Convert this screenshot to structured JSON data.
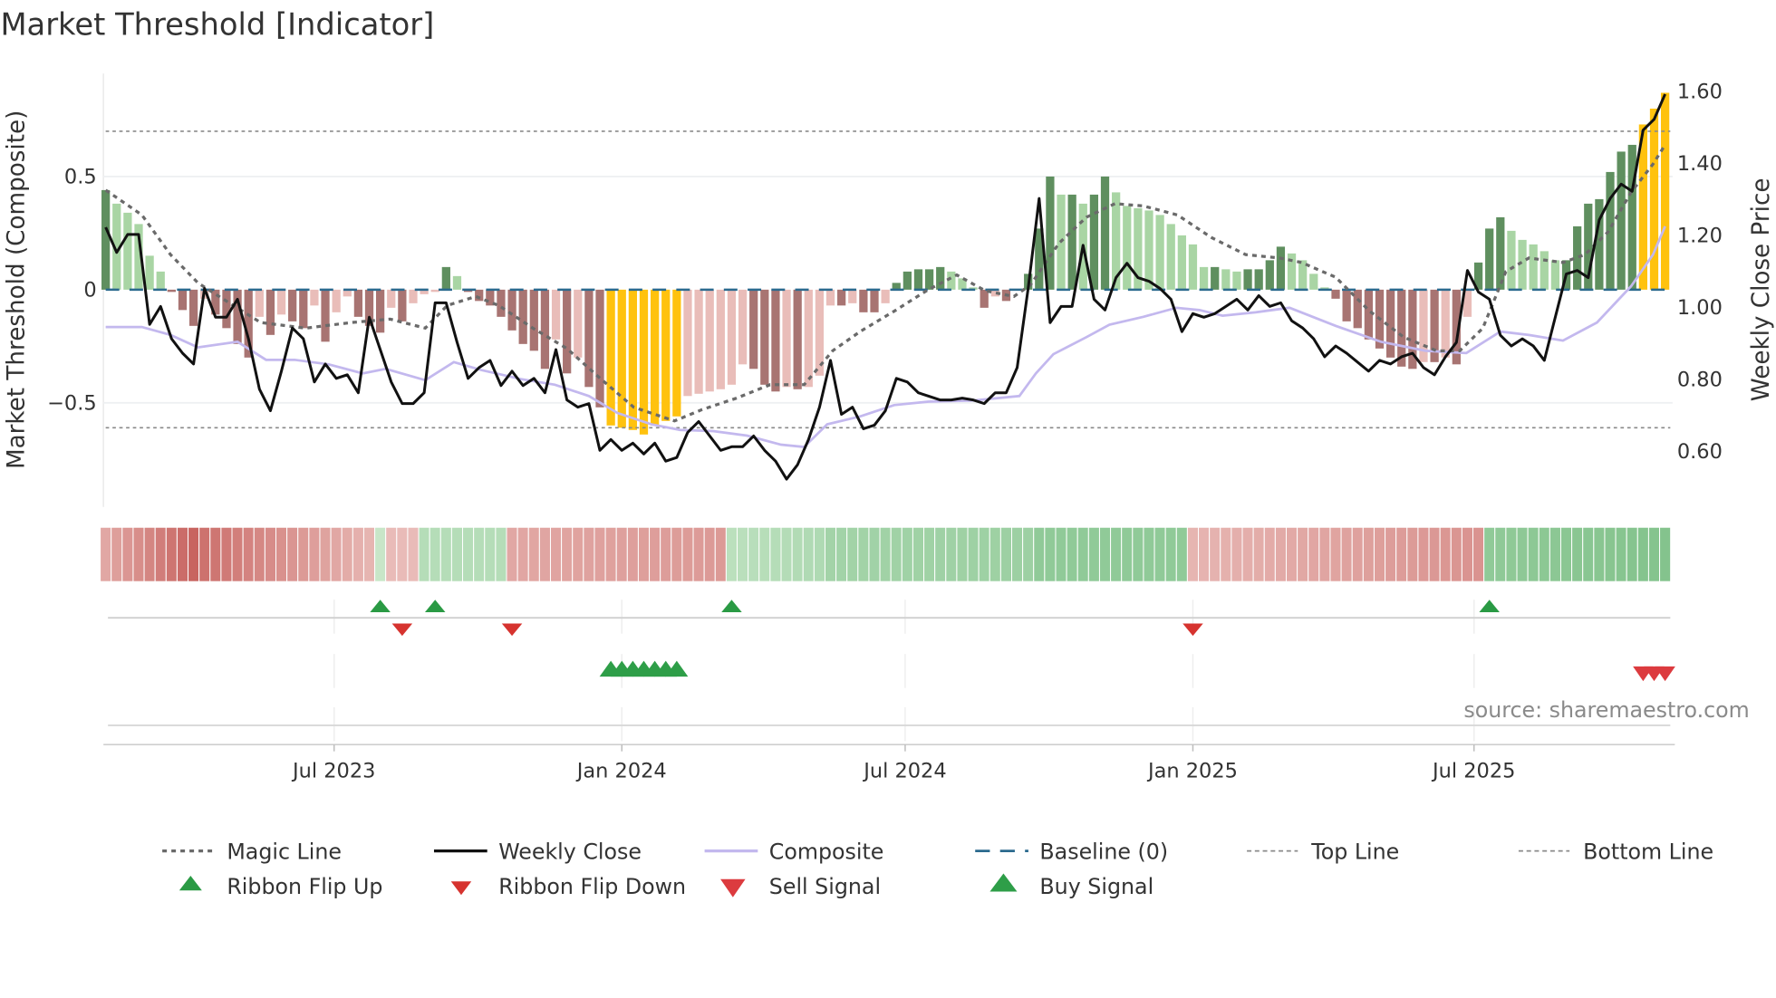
{
  "title": "Market Threshold [Indicator]",
  "source": "source: sharemaestro.com",
  "colors": {
    "bull_strong": "#5f8f5f",
    "bull_weak": "#a9d5a4",
    "bear_strong": "#a87472",
    "bear_weak": "#e9bdb9",
    "extreme": "#ffc20e",
    "close": "#111111",
    "composite": "#c3b8ee",
    "magic": "#6a6a6a",
    "baseline": "#2b6a8e",
    "threshold": "#8a8a8a",
    "flip_up": "#2a9a44",
    "flip_down": "#d6332f",
    "buy": "#2e9e48",
    "sell": "#dc3b3f"
  },
  "chart_data": {
    "type": "bar+line",
    "title": "Market Threshold [Indicator]",
    "ylabel": "Market Threshold (Composite)",
    "y2label": "Weekly Close Price",
    "ylim": [
      -0.95,
      0.96
    ],
    "y2lim": [
      0.45,
      1.65
    ],
    "y_ticks": [
      {
        "label": "0.5",
        "value": 0.5
      },
      {
        "label": "0",
        "value": 0
      },
      {
        "label": "−0.5",
        "value": -0.5
      }
    ],
    "y2_ticks": [
      {
        "label": "1.60",
        "value": 1.6
      },
      {
        "label": "1.40",
        "value": 1.4
      },
      {
        "label": "1.20",
        "value": 1.2
      },
      {
        "label": "1.00",
        "value": 1.0
      },
      {
        "label": "0.80",
        "value": 0.8
      },
      {
        "label": "0.60",
        "value": 0.6
      }
    ],
    "x_ticks": [
      {
        "label": "Jul 2023",
        "week": 20.8
      },
      {
        "label": "Jan 2024",
        "week": 47.0
      },
      {
        "label": "Jul 2024",
        "week": 72.8
      },
      {
        "label": "Jan 2025",
        "week": 99.0
      },
      {
        "label": "Jul 2025",
        "week": 124.6
      }
    ],
    "top_line": 0.7,
    "bottom_line": -0.61,
    "baseline": 0,
    "histogram": [
      0.44,
      0.38,
      0.34,
      0.29,
      0.15,
      0.08,
      -0.01,
      -0.09,
      -0.16,
      -0.04,
      -0.11,
      -0.17,
      -0.24,
      -0.3,
      -0.12,
      -0.2,
      -0.11,
      -0.14,
      -0.17,
      -0.07,
      -0.23,
      -0.1,
      -0.03,
      -0.12,
      -0.16,
      -0.19,
      -0.08,
      -0.14,
      -0.06,
      -0.02,
      -0.01,
      0.1,
      0.06,
      -0.01,
      -0.05,
      -0.07,
      -0.12,
      -0.18,
      -0.24,
      -0.27,
      -0.35,
      -0.22,
      -0.37,
      -0.3,
      -0.43,
      -0.52,
      -0.6,
      -0.61,
      -0.62,
      -0.64,
      -0.6,
      -0.58,
      -0.56,
      -0.47,
      -0.46,
      -0.45,
      -0.44,
      -0.42,
      -0.33,
      -0.35,
      -0.42,
      -0.45,
      -0.43,
      -0.44,
      -0.43,
      -0.38,
      -0.07,
      -0.07,
      -0.06,
      -0.1,
      -0.1,
      -0.06,
      0.03,
      0.08,
      0.09,
      0.09,
      0.1,
      0.08,
      0.05,
      0.01,
      -0.08,
      -0.03,
      -0.05,
      0.0,
      0.07,
      0.27,
      0.5,
      0.42,
      0.42,
      0.38,
      0.42,
      0.5,
      0.43,
      0.37,
      0.36,
      0.35,
      0.33,
      0.29,
      0.24,
      0.2,
      0.1,
      0.1,
      0.09,
      0.08,
      0.09,
      0.09,
      0.13,
      0.19,
      0.16,
      0.13,
      0.07,
      0.01,
      -0.04,
      -0.14,
      -0.17,
      -0.22,
      -0.26,
      -0.3,
      -0.34,
      -0.35,
      -0.32,
      -0.32,
      -0.3,
      -0.33,
      -0.12,
      0.12,
      0.27,
      0.32,
      0.26,
      0.22,
      0.2,
      0.17,
      0.13,
      0.13,
      0.28,
      0.38,
      0.4,
      0.52,
      0.61,
      0.64,
      0.73,
      0.8,
      0.87
    ],
    "weekly_close": [
      1.22,
      1.15,
      1.2,
      1.2,
      0.95,
      1.0,
      0.91,
      0.87,
      0.84,
      1.05,
      0.97,
      0.97,
      1.02,
      0.91,
      0.77,
      0.71,
      0.82,
      0.94,
      0.91,
      0.79,
      0.84,
      0.8,
      0.81,
      0.76,
      0.97,
      0.88,
      0.79,
      0.73,
      0.73,
      0.76,
      1.01,
      1.01,
      0.9,
      0.8,
      0.83,
      0.85,
      0.78,
      0.82,
      0.78,
      0.8,
      0.76,
      0.88,
      0.74,
      0.72,
      0.73,
      0.6,
      0.63,
      0.6,
      0.62,
      0.59,
      0.62,
      0.57,
      0.58,
      0.65,
      0.68,
      0.64,
      0.6,
      0.61,
      0.61,
      0.64,
      0.6,
      0.57,
      0.52,
      0.56,
      0.63,
      0.72,
      0.85,
      0.7,
      0.72,
      0.66,
      0.67,
      0.71,
      0.8,
      0.79,
      0.76,
      0.75,
      0.74,
      0.74,
      0.745,
      0.74,
      0.73,
      0.76,
      0.76,
      0.83,
      1.05,
      1.3,
      0.955,
      1.0,
      1.0,
      1.17,
      1.02,
      0.99,
      1.08,
      1.12,
      1.08,
      1.07,
      1.05,
      1.02,
      0.93,
      0.98,
      0.97,
      0.98,
      1.0,
      1.02,
      0.99,
      1.03,
      1.0,
      1.01,
      0.96,
      0.94,
      0.91,
      0.86,
      0.89,
      0.87,
      0.845,
      0.82,
      0.85,
      0.84,
      0.86,
      0.87,
      0.83,
      0.81,
      0.86,
      0.9,
      1.1,
      1.04,
      1.02,
      0.92,
      0.89,
      0.91,
      0.89,
      0.85,
      0.97,
      1.09,
      1.1,
      1.08,
      1.24,
      1.3,
      1.34,
      1.32,
      1.49,
      1.52,
      1.59
    ],
    "composite": [
      [
        0,
        -0.165
      ],
      [
        3.3,
        -0.165
      ],
      [
        5.9,
        -0.2
      ],
      [
        8.4,
        -0.255
      ],
      [
        12,
        -0.23
      ],
      [
        14.6,
        -0.31
      ],
      [
        17.2,
        -0.31
      ],
      [
        20.3,
        -0.33
      ],
      [
        23.4,
        -0.37
      ],
      [
        25.5,
        -0.35
      ],
      [
        29.1,
        -0.4
      ],
      [
        31.7,
        -0.32
      ],
      [
        34.2,
        -0.355
      ],
      [
        37.8,
        -0.395
      ],
      [
        40.9,
        -0.42
      ],
      [
        44,
        -0.47
      ],
      [
        46.6,
        -0.545
      ],
      [
        49.7,
        -0.595
      ],
      [
        52.3,
        -0.62
      ],
      [
        55.3,
        -0.625
      ],
      [
        58.4,
        -0.645
      ],
      [
        61.5,
        -0.685
      ],
      [
        63.6,
        -0.695
      ],
      [
        65.7,
        -0.595
      ],
      [
        68.7,
        -0.56
      ],
      [
        71.8,
        -0.51
      ],
      [
        74.9,
        -0.495
      ],
      [
        79,
        -0.49
      ],
      [
        83.2,
        -0.47
      ],
      [
        84.7,
        -0.37
      ],
      [
        86.3,
        -0.285
      ],
      [
        89.3,
        -0.21
      ],
      [
        91.4,
        -0.155
      ],
      [
        94.5,
        -0.12
      ],
      [
        97.5,
        -0.08
      ],
      [
        99.6,
        -0.09
      ],
      [
        101.7,
        -0.115
      ],
      [
        104.7,
        -0.1
      ],
      [
        107.8,
        -0.08
      ],
      [
        112,
        -0.16
      ],
      [
        116.1,
        -0.23
      ],
      [
        120.2,
        -0.27
      ],
      [
        123.9,
        -0.28
      ],
      [
        127,
        -0.185
      ],
      [
        129.6,
        -0.2
      ],
      [
        132.7,
        -0.225
      ],
      [
        135.8,
        -0.145
      ],
      [
        138.9,
        0.015
      ],
      [
        140.9,
        0.155
      ],
      [
        142,
        0.28
      ]
    ],
    "magic_line": [
      [
        0,
        0.44
      ],
      [
        3.3,
        0.33
      ],
      [
        5.9,
        0.155
      ],
      [
        8.4,
        0.03
      ],
      [
        10,
        -0.02
      ],
      [
        14.1,
        -0.145
      ],
      [
        18.2,
        -0.17
      ],
      [
        22.4,
        -0.145
      ],
      [
        25.9,
        -0.13
      ],
      [
        29.1,
        -0.17
      ],
      [
        31.1,
        -0.07
      ],
      [
        33.7,
        -0.03
      ],
      [
        35.8,
        -0.07
      ],
      [
        38.9,
        -0.17
      ],
      [
        42,
        -0.26
      ],
      [
        45.1,
        -0.395
      ],
      [
        48.1,
        -0.52
      ],
      [
        51.8,
        -0.58
      ],
      [
        54.3,
        -0.53
      ],
      [
        57.4,
        -0.48
      ],
      [
        60.5,
        -0.42
      ],
      [
        63.6,
        -0.42
      ],
      [
        66.2,
        -0.27
      ],
      [
        68.7,
        -0.185
      ],
      [
        71.8,
        -0.095
      ],
      [
        74.9,
        0.0
      ],
      [
        77.5,
        0.065
      ],
      [
        80.1,
        -0.005
      ],
      [
        82.7,
        -0.03
      ],
      [
        84.2,
        0.02
      ],
      [
        86.8,
        0.205
      ],
      [
        89.3,
        0.32
      ],
      [
        91.9,
        0.38
      ],
      [
        94.5,
        0.37
      ],
      [
        97.6,
        0.33
      ],
      [
        100.7,
        0.23
      ],
      [
        103.8,
        0.155
      ],
      [
        106.9,
        0.14
      ],
      [
        108.9,
        0.12
      ],
      [
        112,
        0.055
      ],
      [
        115.1,
        -0.095
      ],
      [
        118.2,
        -0.21
      ],
      [
        121.2,
        -0.27
      ],
      [
        123.3,
        -0.27
      ],
      [
        125.4,
        -0.17
      ],
      [
        127.5,
        0.08
      ],
      [
        129.6,
        0.14
      ],
      [
        132.7,
        0.12
      ],
      [
        134.7,
        0.155
      ],
      [
        136.8,
        0.255
      ],
      [
        138.9,
        0.43
      ],
      [
        140.9,
        0.555
      ],
      [
        142,
        0.64
      ]
    ],
    "ribbon_segments": [
      {
        "from": 0,
        "to": 8,
        "state": "bear",
        "start": 0.35,
        "end": 0.85
      },
      {
        "from": 9,
        "to": 24,
        "state": "bear",
        "start": 0.75,
        "end": 0.25
      },
      {
        "from": 25,
        "to": 25,
        "state": "bull",
        "start": 0.15,
        "end": 0.15
      },
      {
        "from": 26,
        "to": 28,
        "state": "bear",
        "start": 0.2,
        "end": 0.2
      },
      {
        "from": 29,
        "to": 36,
        "state": "bull",
        "start": 0.3,
        "end": 0.3
      },
      {
        "from": 37,
        "to": 56,
        "state": "bear",
        "start": 0.35,
        "end": 0.45
      },
      {
        "from": 57,
        "to": 65,
        "state": "bull",
        "start": 0.25,
        "end": 0.35
      },
      {
        "from": 66,
        "to": 84,
        "state": "bull",
        "start": 0.45,
        "end": 0.5
      },
      {
        "from": 85,
        "to": 98,
        "state": "bull",
        "start": 0.6,
        "end": 0.6
      },
      {
        "from": 99,
        "to": 125,
        "state": "bear",
        "start": 0.25,
        "end": 0.5
      },
      {
        "from": 126,
        "to": 142,
        "state": "bull",
        "start": 0.6,
        "end": 0.7
      }
    ],
    "signals": {
      "ribbon_flip_up": [
        25,
        30,
        57,
        126
      ],
      "ribbon_flip_down": [
        27,
        37,
        99
      ],
      "buy": [
        46,
        47,
        48,
        49,
        50,
        51,
        52
      ],
      "sell": [
        140,
        141,
        142
      ]
    }
  },
  "legend": {
    "magic_line": "Magic Line",
    "weekly_close": "Weekly Close",
    "composite": "Composite",
    "baseline": "Baseline (0)",
    "top_line": "Top Line",
    "bottom_line": "Bottom Line",
    "ribbon_flip_up": "Ribbon Flip Up",
    "ribbon_flip_down": "Ribbon Flip Down",
    "sell_signal": "Sell Signal",
    "buy_signal": "Buy Signal"
  }
}
